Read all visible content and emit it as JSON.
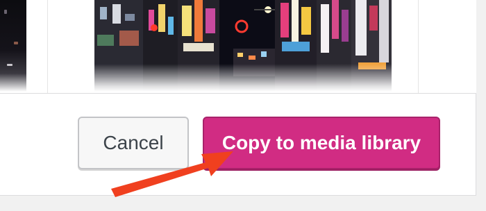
{
  "dialog": {
    "cancel_label": "Cancel",
    "copy_label": "Copy to media library"
  },
  "colors": {
    "primary_button": "#d12c83",
    "secondary_button": "#f7f7f7",
    "annotation_arrow": "#f0401f"
  },
  "icons": {
    "annotation": "red-arrow-icon"
  }
}
